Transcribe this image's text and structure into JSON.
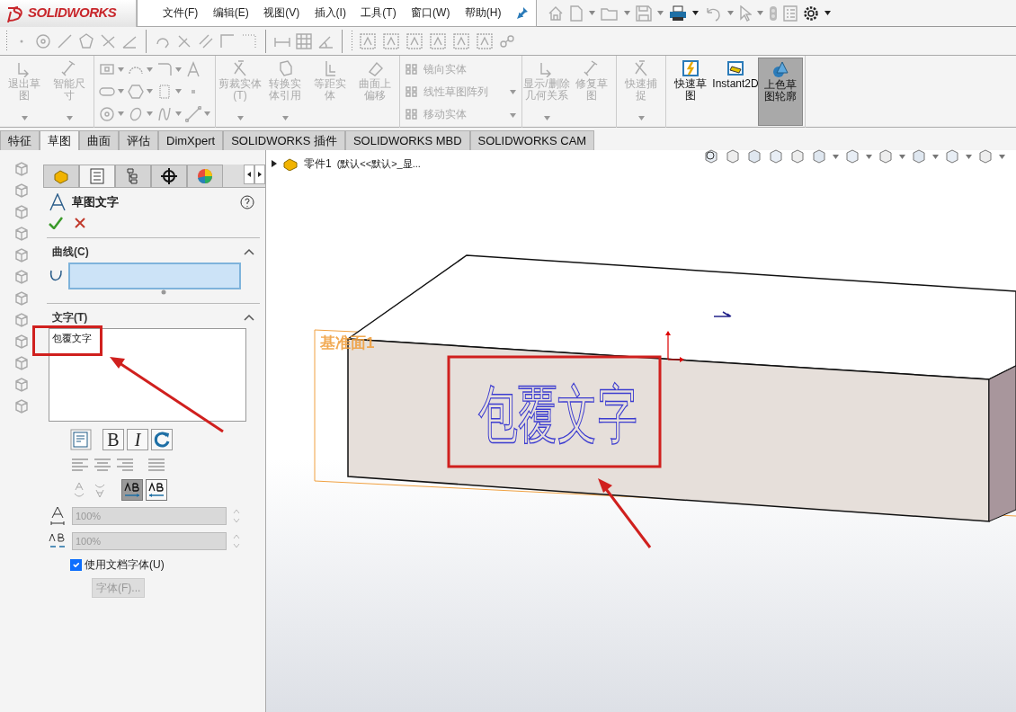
{
  "menu_bar": {
    "logo": "SOLIDWORKS",
    "items": [
      "文件(F)",
      "编辑(E)",
      "视图(V)",
      "插入(I)",
      "工具(T)",
      "窗口(W)",
      "帮助(H)"
    ]
  },
  "command_groups": [
    {
      "kind": "large",
      "buttons": [
        {
          "label": "退出草图",
          "disabled": true,
          "dropdown": true
        },
        {
          "label": "智能尺寸",
          "disabled": true,
          "dropdown": true
        }
      ]
    },
    {
      "kind": "icon_grid"
    },
    {
      "kind": "large",
      "buttons": [
        {
          "label": "剪裁实体(T)",
          "disabled": true,
          "dropdown": true
        },
        {
          "label": "转换实体引用",
          "disabled": true,
          "dropdown": true
        },
        {
          "label": "等距实体",
          "disabled": true,
          "dropdown": false
        },
        {
          "label": "曲面上偏移",
          "disabled": true,
          "dropdown": false
        }
      ]
    },
    {
      "kind": "list",
      "buttons": [
        {
          "label": "镜向实体",
          "disabled": true,
          "dropdown": false
        },
        {
          "label": "线性草图阵列",
          "disabled": true,
          "dropdown": true
        },
        {
          "label": "移动实体",
          "disabled": true,
          "dropdown": true
        }
      ]
    },
    {
      "kind": "large",
      "buttons": [
        {
          "label": "显示/删除几何关系",
          "disabled": true,
          "dropdown": true
        },
        {
          "label": "修复草图",
          "disabled": true,
          "dropdown": false
        }
      ]
    },
    {
      "kind": "large",
      "buttons": [
        {
          "label": "快速捕捉",
          "disabled": true,
          "dropdown": true
        }
      ]
    },
    {
      "kind": "large",
      "buttons": [
        {
          "label": "快速草图",
          "disabled": false,
          "dropdown": false,
          "active": false
        },
        {
          "label": "Instant2D",
          "disabled": false,
          "dropdown": false,
          "active": false
        },
        {
          "label": "上色草图轮廓",
          "disabled": false,
          "dropdown": false,
          "active": true
        }
      ]
    }
  ],
  "tabs": [
    {
      "label": "特征",
      "selected": false
    },
    {
      "label": "草图",
      "selected": true
    },
    {
      "label": "曲面",
      "selected": false
    },
    {
      "label": "评估",
      "selected": false
    },
    {
      "label": "DimXpert",
      "selected": false
    },
    {
      "label": "SOLIDWORKS 插件",
      "selected": false
    },
    {
      "label": "SOLIDWORKS MBD",
      "selected": false
    },
    {
      "label": "SOLIDWORKS CAM",
      "selected": false
    }
  ],
  "property_manager": {
    "title": "草图文字",
    "sections": [
      {
        "title": "曲线(C)",
        "expanded": true
      },
      {
        "title": "文字(T)",
        "expanded": true
      }
    ],
    "text_value": "包覆文字",
    "style_buttons": [
      {
        "kind": "bold",
        "label": "B",
        "on": false
      },
      {
        "kind": "italic",
        "label": "I",
        "on": false
      }
    ],
    "direction_buttons": [
      {
        "selected": true
      },
      {
        "selected": false
      }
    ],
    "spacing_fields": [
      {
        "value": "100%",
        "disabled": true
      },
      {
        "value": "100%",
        "disabled": true
      }
    ],
    "use_doc_font": {
      "label": "使用文档字体(U)",
      "checked": true
    },
    "font_button": {
      "label": "字体(F)...",
      "disabled": true
    }
  },
  "graphics": {
    "tree": {
      "part": "零件1",
      "config": "(默认<<默认>_显..."
    },
    "plane_label": "基准面1",
    "wrap_text": "包覆文字"
  }
}
